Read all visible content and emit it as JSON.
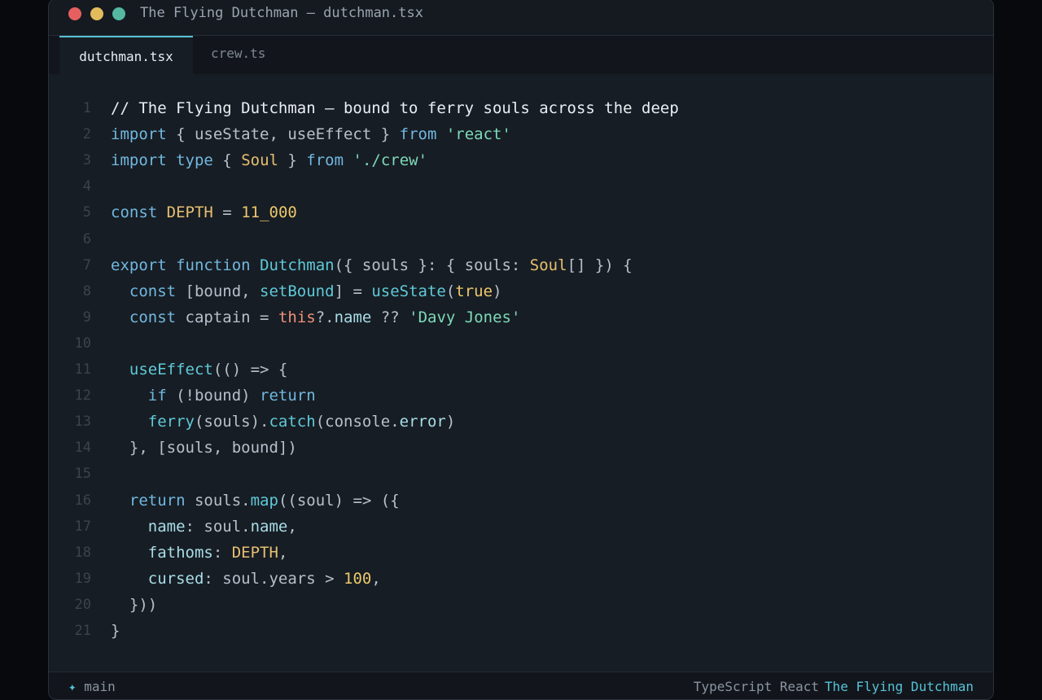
{
  "window": {
    "title": "The Flying Dutchman — dutchman.tsx"
  },
  "tabs": [
    {
      "label": "dutchman.tsx",
      "active": true
    },
    {
      "label": "crew.ts",
      "active": false
    }
  ],
  "editor": {
    "language": "TypeScript React",
    "lines": [
      {
        "n": "1",
        "tokens": [
          {
            "t": "// The Flying Dutchman — bound to ferry souls across the deep",
            "c": "cm"
          }
        ]
      },
      {
        "n": "2",
        "tokens": [
          {
            "t": "import",
            "c": "kw"
          },
          {
            "t": " { useState, useEffect } ",
            "c": ""
          },
          {
            "t": "from",
            "c": "kw"
          },
          {
            "t": " ",
            "c": ""
          },
          {
            "t": "'react'",
            "c": "str"
          }
        ]
      },
      {
        "n": "3",
        "tokens": [
          {
            "t": "import",
            "c": "kw"
          },
          {
            "t": " ",
            "c": ""
          },
          {
            "t": "type",
            "c": "kw"
          },
          {
            "t": " { ",
            "c": ""
          },
          {
            "t": "Soul",
            "c": "ty"
          },
          {
            "t": " } ",
            "c": ""
          },
          {
            "t": "from",
            "c": "kw"
          },
          {
            "t": " ",
            "c": ""
          },
          {
            "t": "'./crew'",
            "c": "str"
          }
        ]
      },
      {
        "n": "4",
        "tokens": []
      },
      {
        "n": "5",
        "tokens": [
          {
            "t": "const",
            "c": "kw"
          },
          {
            "t": " ",
            "c": ""
          },
          {
            "t": "DEPTH",
            "c": "ty"
          },
          {
            "t": " = ",
            "c": ""
          },
          {
            "t": "11_000",
            "c": "num"
          }
        ]
      },
      {
        "n": "6",
        "tokens": []
      },
      {
        "n": "7",
        "tokens": [
          {
            "t": "export",
            "c": "kw"
          },
          {
            "t": " ",
            "c": ""
          },
          {
            "t": "function",
            "c": "kw"
          },
          {
            "t": " ",
            "c": ""
          },
          {
            "t": "Dutchman",
            "c": "fn"
          },
          {
            "t": "({ souls }: { souls: ",
            "c": ""
          },
          {
            "t": "Soul",
            "c": "ty"
          },
          {
            "t": "[] }) {",
            "c": ""
          }
        ]
      },
      {
        "n": "8",
        "tokens": [
          {
            "t": "  ",
            "c": ""
          },
          {
            "t": "const",
            "c": "kw"
          },
          {
            "t": " [bound, ",
            "c": ""
          },
          {
            "t": "setBound",
            "c": "fn"
          },
          {
            "t": "] = ",
            "c": ""
          },
          {
            "t": "useState",
            "c": "fn"
          },
          {
            "t": "(",
            "c": ""
          },
          {
            "t": "true",
            "c": "num"
          },
          {
            "t": ")",
            "c": ""
          }
        ]
      },
      {
        "n": "9",
        "tokens": [
          {
            "t": "  ",
            "c": ""
          },
          {
            "t": "const",
            "c": "kw"
          },
          {
            "t": " captain = ",
            "c": ""
          },
          {
            "t": "this",
            "c": "this"
          },
          {
            "t": "?.",
            "c": ""
          },
          {
            "t": "name",
            "c": "prop"
          },
          {
            "t": " ?? ",
            "c": ""
          },
          {
            "t": "'Davy Jones'",
            "c": "str"
          }
        ]
      },
      {
        "n": "10",
        "tokens": []
      },
      {
        "n": "11",
        "tokens": [
          {
            "t": "  ",
            "c": ""
          },
          {
            "t": "useEffect",
            "c": "fn"
          },
          {
            "t": "(() => {",
            "c": ""
          }
        ]
      },
      {
        "n": "12",
        "tokens": [
          {
            "t": "    ",
            "c": ""
          },
          {
            "t": "if",
            "c": "kw"
          },
          {
            "t": " (!bound) ",
            "c": ""
          },
          {
            "t": "return",
            "c": "kw"
          }
        ]
      },
      {
        "n": "13",
        "tokens": [
          {
            "t": "    ",
            "c": ""
          },
          {
            "t": "ferry",
            "c": "fn"
          },
          {
            "t": "(souls).",
            "c": ""
          },
          {
            "t": "catch",
            "c": "fn"
          },
          {
            "t": "(console.",
            "c": ""
          },
          {
            "t": "error",
            "c": "prop"
          },
          {
            "t": ")",
            "c": ""
          }
        ]
      },
      {
        "n": "14",
        "tokens": [
          {
            "t": "  }, [souls, bound])",
            "c": ""
          }
        ]
      },
      {
        "n": "15",
        "tokens": []
      },
      {
        "n": "16",
        "tokens": [
          {
            "t": "  ",
            "c": ""
          },
          {
            "t": "return",
            "c": "kw"
          },
          {
            "t": " souls.",
            "c": ""
          },
          {
            "t": "map",
            "c": "fn"
          },
          {
            "t": "((soul) => ({",
            "c": ""
          }
        ]
      },
      {
        "n": "17",
        "tokens": [
          {
            "t": "    ",
            "c": ""
          },
          {
            "t": "name",
            "c": "prop"
          },
          {
            "t": ": soul.",
            "c": ""
          },
          {
            "t": "name",
            "c": "prop"
          },
          {
            "t": ",",
            "c": ""
          }
        ]
      },
      {
        "n": "18",
        "tokens": [
          {
            "t": "    ",
            "c": ""
          },
          {
            "t": "fathoms",
            "c": "prop"
          },
          {
            "t": ": ",
            "c": ""
          },
          {
            "t": "DEPTH",
            "c": "ty"
          },
          {
            "t": ",",
            "c": ""
          }
        ]
      },
      {
        "n": "19",
        "tokens": [
          {
            "t": "    ",
            "c": ""
          },
          {
            "t": "cursed",
            "c": "prop"
          },
          {
            "t": ": soul.years > ",
            "c": ""
          },
          {
            "t": "100",
            "c": "num"
          },
          {
            "t": ",",
            "c": ""
          }
        ]
      },
      {
        "n": "20",
        "tokens": [
          {
            "t": "  }))",
            "c": ""
          }
        ]
      },
      {
        "n": "21",
        "tokens": [
          {
            "t": "}",
            "c": ""
          }
        ]
      }
    ]
  },
  "statusbar": {
    "branch_icon": "✦",
    "branch": "main",
    "language": "TypeScript React",
    "project": "The Flying Dutchman"
  },
  "colors": {
    "accent": "#56c2d6",
    "keyword": "#70b8e0",
    "function": "#5fc9d8",
    "string": "#7ddab8",
    "type": "#e6c071",
    "number": "#ecc86c",
    "background": "#171d24"
  }
}
